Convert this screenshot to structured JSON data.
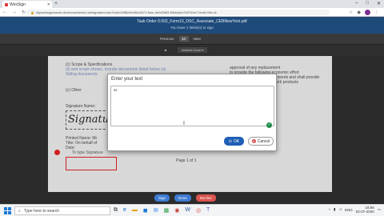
{
  "browser": {
    "tab_title": "WesSign",
    "new_tab": "+",
    "window_buttons": [
      "–",
      "□",
      "✕"
    ],
    "url": "shpwebsignnamer.devtronewhesek.net/signatrecords?buid=f0ff6e0e49bc0d71-fsee-de2d0b83-f0fcbabe-f0d7f1be7-fec6t-00b-dc",
    "nav_back": "←",
    "nav_forward": "→",
    "nav_reload": "↻"
  },
  "document": {
    "title": "Task Order 0.002_Form10_DSC_Associate_CEBNewYork.pdf",
    "required": "You have 1 fields(s) to sign",
    "pager_prev": "Previous",
    "page_number": "10",
    "pager_next": "Next",
    "toolbar_left": "◀",
    "toolbar_label": "Address Done ▾",
    "lines": [
      "(c) Scope & Specifications",
      "(ii) and scope shown, include documents listed below (at",
      "Siding documents",
      "(c) Other",
      "Signature Name:",
      "Printed Name: Mr.",
      "Title: On behalf of",
      "Date:"
    ],
    "right_lines": [
      "approval of any replacement",
      "to provide the following economic effort",
      "to comply with any special needs and shall provide",
      "at all times if any and all work products"
    ],
    "signature_text": "Signature",
    "bottom_text": "Page 1 of 1",
    "field_label": "To type Signature"
  },
  "dialog": {
    "title": "Enter your text",
    "value": "ss",
    "ok_label": "OK",
    "cancel_label": "Cancel"
  },
  "actions": {
    "buttons": [
      {
        "label": "Sign",
        "color": "#3d7bd1"
      },
      {
        "label": "Done",
        "color": "#3d7bd1"
      },
      {
        "label": "Decline",
        "color": "#d9534f"
      }
    ]
  },
  "taskbar": {
    "search_placeholder": "Type here to search",
    "tray_lang": "ENG",
    "time": "18:56",
    "date": "02-07-2020"
  },
  "colors": {
    "header": "#1e4a7a",
    "ok": "#1f5fb5",
    "field_border": "#d21f1f"
  }
}
